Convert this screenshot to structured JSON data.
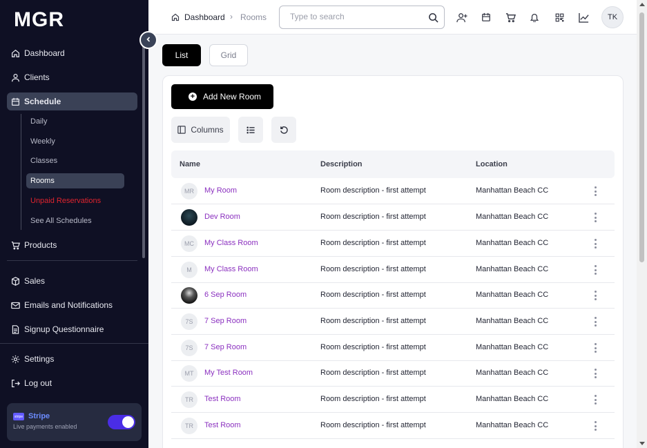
{
  "app": {
    "logo": "MGR"
  },
  "sidebar": {
    "items": [
      {
        "label": "Dashboard",
        "icon": "home-icon"
      },
      {
        "label": "Clients",
        "icon": "user-icon"
      },
      {
        "label": "Schedule",
        "icon": "calendar-icon"
      }
    ],
    "schedule_sub": [
      {
        "label": "Daily"
      },
      {
        "label": "Weekly"
      },
      {
        "label": "Classes"
      },
      {
        "label": "Rooms"
      },
      {
        "label": "Unpaid Reservations"
      },
      {
        "label": "See All Schedules"
      }
    ],
    "products": {
      "label": "Products",
      "icon": "cart-icon"
    },
    "section2": [
      {
        "label": "Sales",
        "icon": "box-icon"
      },
      {
        "label": "Emails and Notifications",
        "icon": "mail-icon"
      },
      {
        "label": "Signup Questionnaire",
        "icon": "document-icon"
      }
    ],
    "section3": [
      {
        "label": "Settings",
        "icon": "gear-icon"
      },
      {
        "label": "Log out",
        "icon": "logout-icon"
      }
    ],
    "stripe": {
      "logo": "stripe",
      "title": "Stripe",
      "subtitle": "Live payments enabled",
      "enabled": true
    }
  },
  "header": {
    "breadcrumb": {
      "home": "Dashboard",
      "current": "Rooms"
    },
    "search": {
      "placeholder": "Type to search",
      "value": ""
    },
    "icons": [
      "add-user-icon",
      "calendar-icon",
      "cart-icon",
      "bell-icon",
      "qr-code-icon",
      "chart-icon"
    ],
    "avatar": "TK"
  },
  "view": {
    "list": "List",
    "grid": "Grid",
    "active": "List"
  },
  "toolbar": {
    "add_label": "Add New Room",
    "columns_label": "Columns"
  },
  "table": {
    "headers": {
      "name": "Name",
      "description": "Description",
      "location": "Location"
    },
    "rows": [
      {
        "initials": "MR",
        "avatar": "initials",
        "name": "My Room",
        "description": "Room description - first attempt",
        "location": "Manhattan Beach CC"
      },
      {
        "initials": "",
        "avatar": "dark-image",
        "name": "Dev Room",
        "description": "Room description - first attempt",
        "location": "Manhattan Beach CC"
      },
      {
        "initials": "MC",
        "avatar": "initials",
        "name": "My Class Room",
        "description": "Room description - first attempt",
        "location": "Manhattan Beach CC"
      },
      {
        "initials": "M",
        "avatar": "initials",
        "name": "My Class Room",
        "description": "Room description - first attempt",
        "location": "Manhattan Beach CC"
      },
      {
        "initials": "",
        "avatar": "photo",
        "name": "6 Sep Room",
        "description": "Room description - first attempt",
        "location": "Manhattan Beach CC"
      },
      {
        "initials": "7S",
        "avatar": "initials",
        "name": "7 Sep Room",
        "description": "Room description - first attempt",
        "location": "Manhattan Beach CC"
      },
      {
        "initials": "7S",
        "avatar": "initials",
        "name": "7 Sep Room",
        "description": "Room description - first attempt",
        "location": "Manhattan Beach CC"
      },
      {
        "initials": "MT",
        "avatar": "initials",
        "name": "My Test Room",
        "description": "Room description - first attempt",
        "location": "Manhattan Beach CC"
      },
      {
        "initials": "TR",
        "avatar": "initials",
        "name": "Test Room",
        "description": "Room description - first attempt",
        "location": "Manhattan Beach CC"
      },
      {
        "initials": "TR",
        "avatar": "initials",
        "name": "Test Room",
        "description": "Room description - first attempt",
        "location": "Manhattan Beach CC"
      }
    ]
  },
  "colors": {
    "sidebar_bg": "#0f1024",
    "active_nav": "#3a4156",
    "link": "#8a2fbf",
    "danger": "#e0242e",
    "stripe_toggle": "#4a2de6"
  }
}
